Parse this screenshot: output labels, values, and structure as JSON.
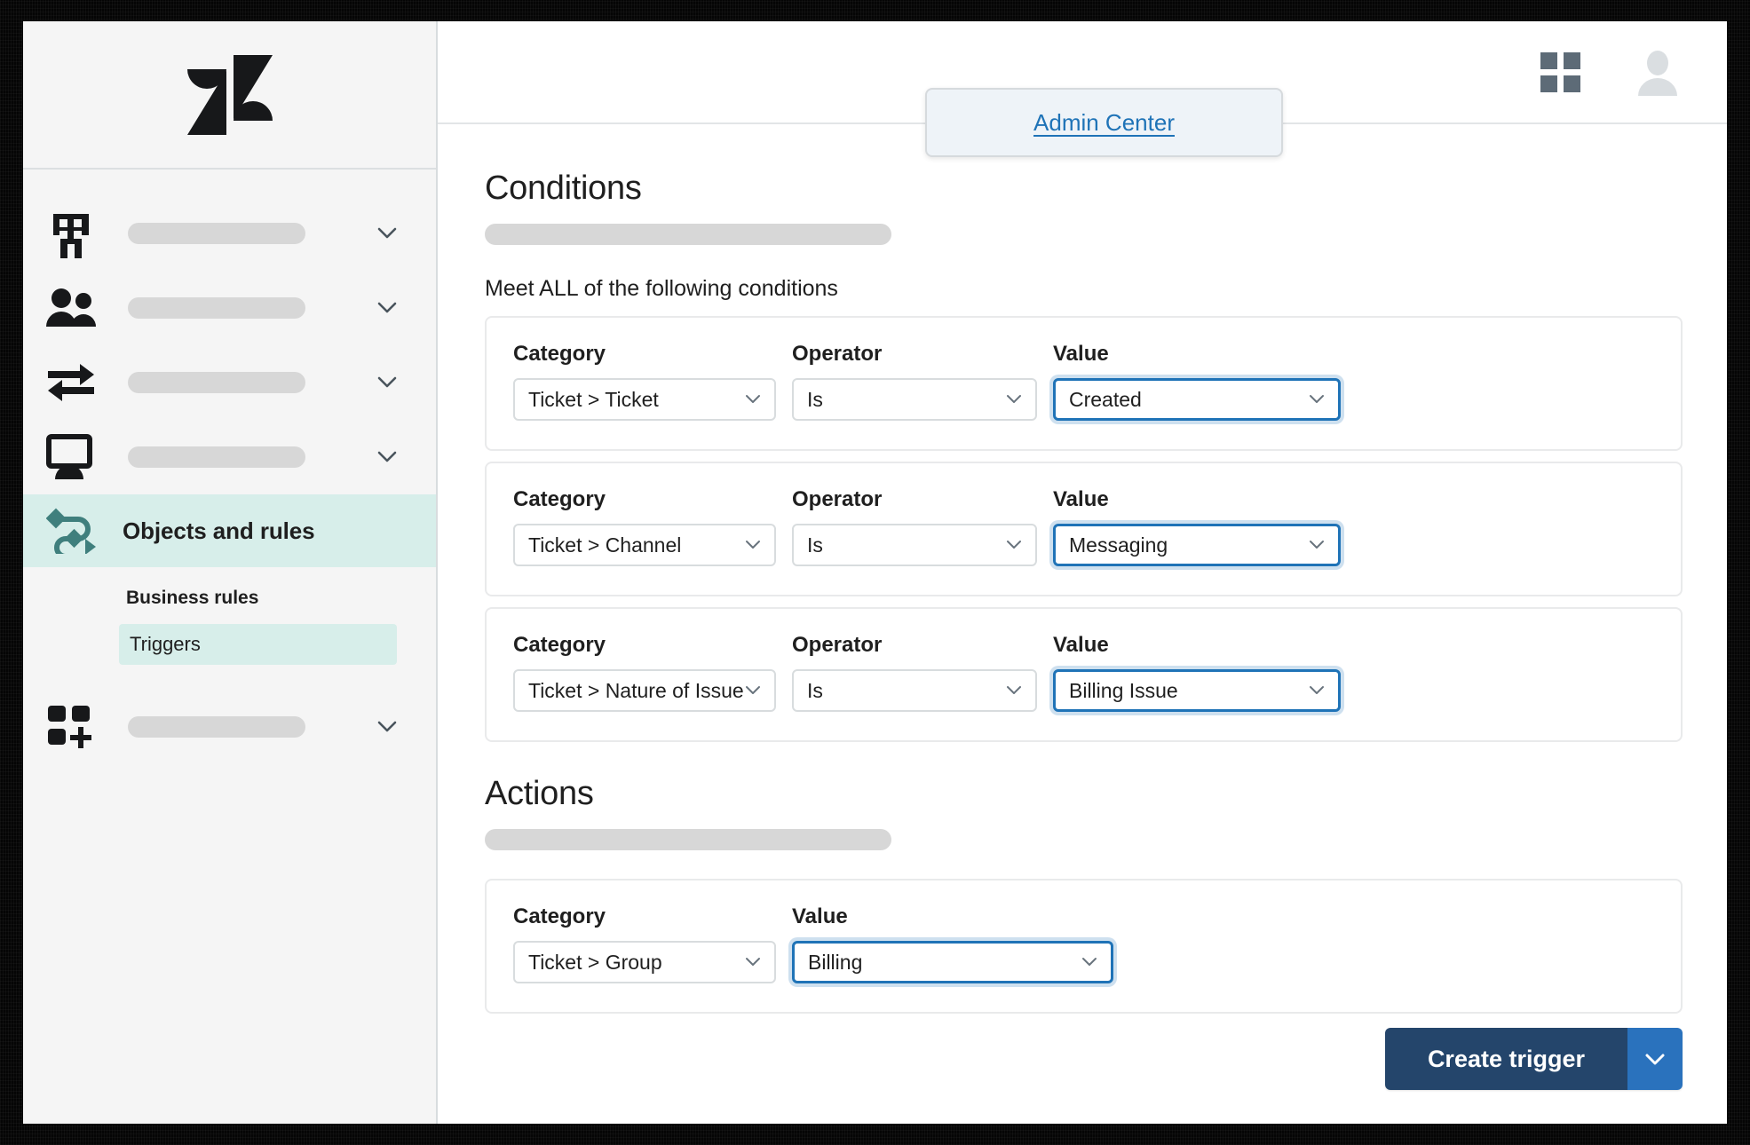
{
  "header": {
    "products_icon": "grid-apps-icon",
    "avatar_icon": "user-avatar-icon",
    "dropdown": {
      "admin_center_label": "Admin Center"
    }
  },
  "sidebar": {
    "logo_icon": "zendesk-logo",
    "items": [
      {
        "icon": "building-icon",
        "label": "",
        "placeholder_bar": true,
        "chevron": "chevron-down-icon",
        "active": false
      },
      {
        "icon": "people-icon",
        "label": "",
        "placeholder_bar": true,
        "chevron": "chevron-down-icon",
        "active": false
      },
      {
        "icon": "transfer-arrows-icon",
        "label": "",
        "placeholder_bar": true,
        "chevron": "chevron-down-icon",
        "active": false
      },
      {
        "icon": "monitor-icon",
        "label": "",
        "placeholder_bar": true,
        "chevron": "chevron-down-icon",
        "active": false
      },
      {
        "icon": "objects-rules-icon",
        "label": "Objects and rules",
        "placeholder_bar": false,
        "chevron": "",
        "active": true
      },
      {
        "icon": "apps-add-icon",
        "label": "",
        "placeholder_bar": true,
        "chevron": "chevron-down-icon",
        "active": false
      }
    ],
    "sub_section": {
      "title": "Business rules",
      "items": [
        {
          "label": "Triggers",
          "selected": true
        }
      ]
    }
  },
  "main": {
    "conditions": {
      "heading": "Conditions",
      "meet_all_label": "Meet ALL of the following conditions",
      "labels": {
        "category": "Category",
        "operator": "Operator",
        "value": "Value"
      },
      "rows": [
        {
          "category": "Ticket > Ticket",
          "operator": "Is",
          "value": "Created",
          "value_focused": true
        },
        {
          "category": "Ticket > Channel",
          "operator": "Is",
          "value": "Messaging",
          "value_focused": true
        },
        {
          "category": "Ticket > Nature of Issue",
          "operator": "Is",
          "value": "Billing Issue",
          "value_focused": true
        }
      ]
    },
    "actions": {
      "heading": "Actions",
      "labels": {
        "category": "Category",
        "value": "Value"
      },
      "rows": [
        {
          "category": "Ticket > Group",
          "value": "Billing",
          "value_focused": true
        }
      ]
    }
  },
  "footer": {
    "create_trigger_label": "Create trigger",
    "caret_icon": "chevron-down-icon"
  },
  "colors": {
    "accent_teal": "#d7eeea",
    "accent_teal_icon": "#3f7f7d",
    "link_blue": "#1f73b7",
    "primary_button": "#24456b",
    "primary_button_caret": "#2a72bd",
    "sidebar_bg": "#f5f5f5",
    "skeleton": "#d7d7d7"
  }
}
